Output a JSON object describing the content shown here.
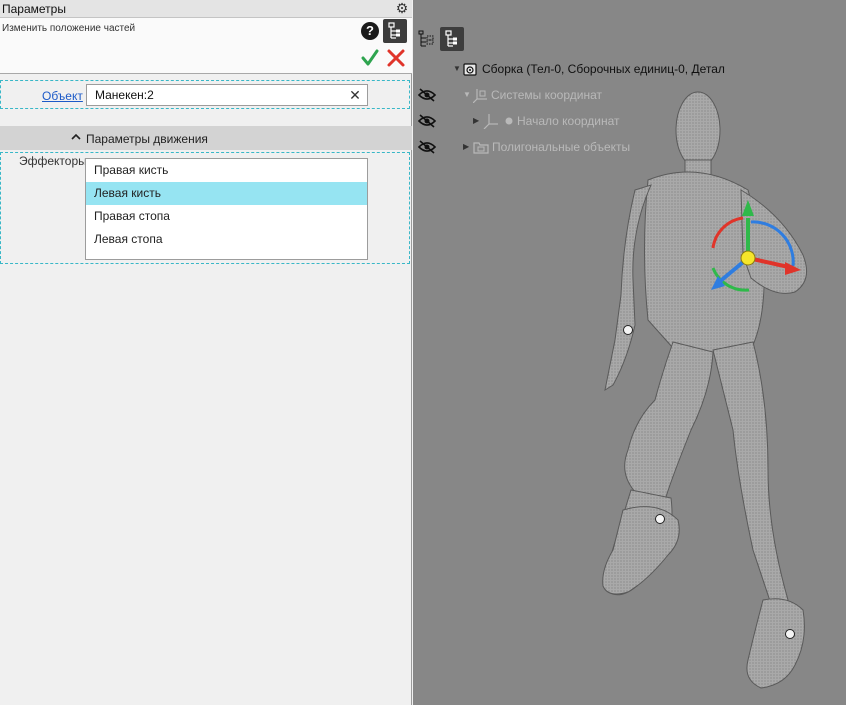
{
  "panel": {
    "title": "Параметры",
    "command": "Изменить положение частей",
    "help_icon": "question-icon",
    "settings_icon": "gear-icon"
  },
  "object_row": {
    "link_label": "Объект",
    "value": "Манекен:2"
  },
  "motion_section": {
    "title": "Параметры движения"
  },
  "effectors": {
    "label": "Эффекторы:",
    "items": [
      {
        "label": "Правая кисть",
        "selected": false
      },
      {
        "label": "Левая кисть",
        "selected": true
      },
      {
        "label": "Правая стопа",
        "selected": false
      },
      {
        "label": "Левая стопа",
        "selected": false
      }
    ]
  },
  "tree": {
    "root": "Сборка (Тел-0, Сборочных единиц-0, Детал",
    "items": [
      {
        "label": "Системы координат"
      },
      {
        "label": "Начало координат"
      },
      {
        "label": "Полигональные объекты"
      }
    ]
  },
  "colors": {
    "selected_row": "#96e4f2",
    "ok": "#2ea44f",
    "cancel": "#e0342a",
    "dashed_border": "#38b7c7",
    "link": "#1c5ac8",
    "viewport_bg": "#878787"
  }
}
